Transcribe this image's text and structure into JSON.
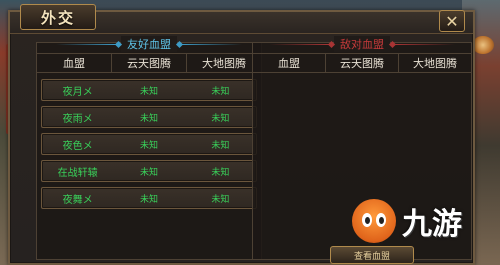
{
  "window": {
    "title": "外交",
    "close_glyph": "✕"
  },
  "friendly": {
    "section_title": "友好血盟",
    "columns": [
      "血盟",
      "云天图腾",
      "大地图腾"
    ],
    "rows": [
      {
        "name": "夜月メ",
        "cloud_totem": "未知",
        "earth_totem": "未知"
      },
      {
        "name": "夜雨メ",
        "cloud_totem": "未知",
        "earth_totem": "未知"
      },
      {
        "name": "夜色メ",
        "cloud_totem": "未知",
        "earth_totem": "未知"
      },
      {
        "name": "在战轩辕",
        "cloud_totem": "未知",
        "earth_totem": "未知"
      },
      {
        "name": "夜舞メ",
        "cloud_totem": "未知",
        "earth_totem": "未知"
      }
    ]
  },
  "enemy": {
    "section_title": "敌对血盟",
    "columns": [
      "血盟",
      "云天图腾",
      "大地图腾"
    ]
  },
  "bottom_button": "查看血盟",
  "watermark": {
    "text": "九游"
  },
  "colors": {
    "friendly_accent": "#5fc4e9",
    "enemy_accent": "#c63a3a",
    "status_green": "#39d15a",
    "gold_border": "#b08a4c"
  }
}
